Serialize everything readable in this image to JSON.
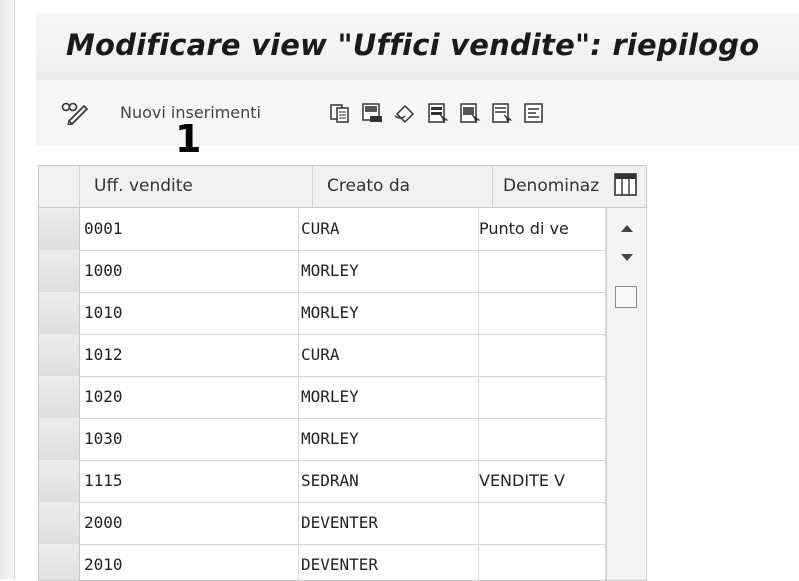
{
  "window": {
    "title": "Modificare view \"Uffici vendite\": riepilogo"
  },
  "toolbar": {
    "new_entries_label": "Nuovi inserimenti",
    "icons": [
      "pencil-glasses-icon",
      "copy-icon",
      "save-variant-icon",
      "undo-icon",
      "select-all-icon",
      "select-block-icon",
      "deselect-icon",
      "details-icon"
    ]
  },
  "callout": {
    "number": "1"
  },
  "table": {
    "columns": [
      "Uff. vendite",
      "Creato da",
      "Denominaz"
    ],
    "rows": [
      [
        "0001",
        "CURA",
        "Punto di ve"
      ],
      [
        "1000",
        "MORLEY",
        ""
      ],
      [
        "1010",
        "MORLEY",
        ""
      ],
      [
        "1012",
        "CURA",
        ""
      ],
      [
        "1020",
        "MORLEY",
        ""
      ],
      [
        "1030",
        "MORLEY",
        ""
      ],
      [
        "1115",
        "SEDRAN",
        "VENDITE V"
      ],
      [
        "2000",
        "DEVENTER",
        ""
      ],
      [
        "2010",
        "DEVENTER",
        ""
      ]
    ]
  },
  "colors": {
    "header_bg": "#f1f1f1",
    "row_selector": "#e3e3e3",
    "accent_icon": "#2b2b2b"
  }
}
